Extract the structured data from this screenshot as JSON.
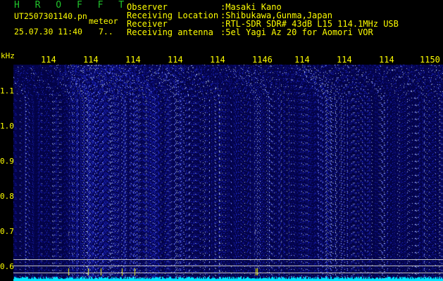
{
  "header": {
    "app_title": "H R O F F T",
    "file_name": "UT2507301140.pn",
    "tag": "meteor",
    "date_time": "25.07.30 11:40",
    "count": "7.."
  },
  "meta": [
    {
      "label": "Observer",
      "value": ":Masaki Kano"
    },
    {
      "label": "Receiving Location",
      "value": ":Shibukawa,Gunma,Japan"
    },
    {
      "label": "Receiver",
      "value": ":RTL-SDR SDR# 43dB L15 114.1MHz USB"
    },
    {
      "label": "Receiving antenna",
      "value": ":5el Yagi Az 20 for Aomori VOR"
    }
  ],
  "axis": {
    "x_unit": "kHz",
    "x_ticks": [
      "114",
      "114",
      "114",
      "114",
      "114",
      "1146",
      "114",
      "114",
      "114",
      "1150"
    ],
    "y_ticks": [
      "1.1",
      "1.0",
      "0.9",
      "0.8",
      "0.7",
      "0.6"
    ]
  },
  "colors": {
    "background": "#000000",
    "text": "#ffff00",
    "title": "#21c32b",
    "noise_base": "#0a0a5c",
    "signal_bottom": "#00e5ff"
  }
}
